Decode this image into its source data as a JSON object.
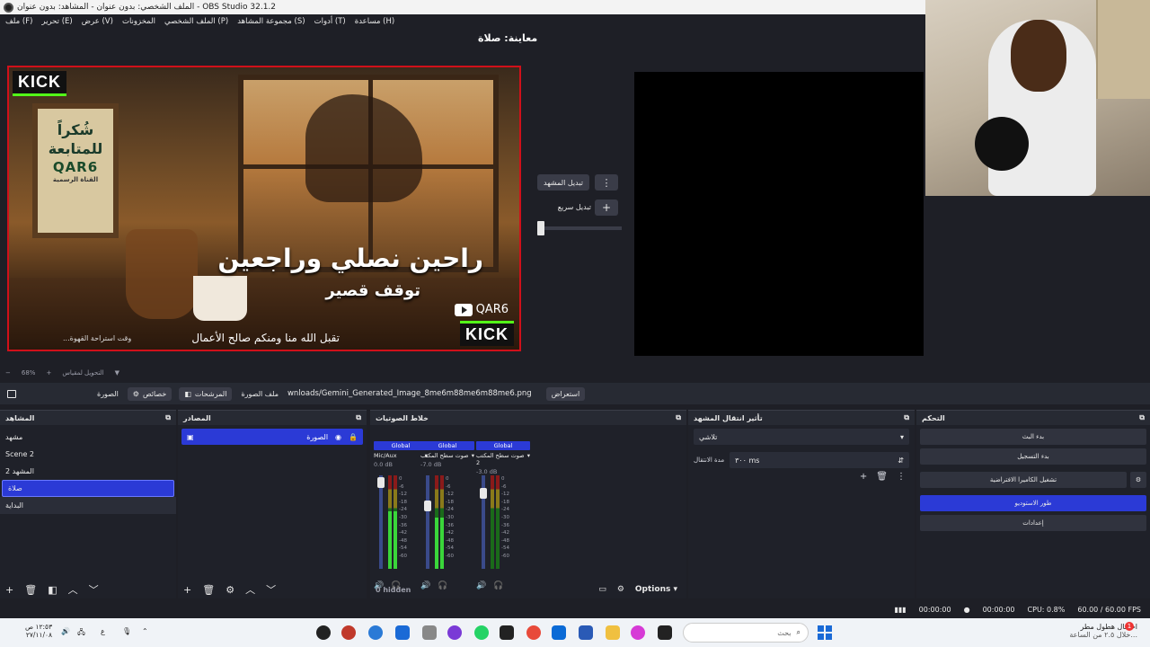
{
  "window": {
    "title": "الملف الشخصي: بدون عنوان - المشاهد: بدون عنوان - OBS Studio 32.1.2"
  },
  "menu": [
    "ملف (F)",
    "تحرير (E)",
    "عرض (V)",
    "المخزونات",
    "الملف الشخصي (P)",
    "مجموعة المشاهد (S)",
    "أدوات (T)",
    "مساعدة (H)"
  ],
  "preview": {
    "label": "معاينة: صلاة"
  },
  "canvas": {
    "kick": "KICK",
    "headline": "راحين نصلي وراجعين",
    "subheadline": "توقف قصير",
    "channel": "QAR6",
    "footer": "تقبل الله منا ومنكم صالح الأعمال",
    "footer_small": "وقت استراحة القهوة...",
    "frame_line1": "شُكراً",
    "frame_line2": "للمتابعة",
    "frame_brand": "QAR6",
    "frame_sub": "القناة الرسمية"
  },
  "transition_controls": {
    "scene_transition": "تبديل المشهد",
    "quick": "تبديل سريع"
  },
  "zoom": {
    "value": "68%",
    "hint": "التحويل لمقياس"
  },
  "context": {
    "source_name": "الصورة",
    "properties": "خصائص",
    "filters": "المرشحات",
    "image_file_label": "ملف الصورة",
    "image_file": "wnloads/Gemini_Generated_Image_8me6m88me6m88me6.png",
    "browse": "استعراض"
  },
  "scenes": {
    "title": "المشاهد",
    "items": [
      "مشهد",
      "Scene 2",
      "المشهد 2",
      "صلاة",
      "البداية"
    ],
    "selected": 3
  },
  "sources": {
    "title": "المصادر",
    "items": [
      {
        "name": "الصورة"
      }
    ]
  },
  "mixer": {
    "title": "خلاط الصوتيات",
    "channels": [
      {
        "global": "Global",
        "name": "Mic/Aux",
        "db": "0.0 dB",
        "level": 0.62
      },
      {
        "global": "Global",
        "name": "صوت سطح المكتب",
        "db": "-7.0 dB",
        "level": 0.55
      },
      {
        "global": "Global",
        "name": "صوت سطح المكتب 2",
        "db": "-3.0 dB",
        "level": 0.0
      }
    ],
    "scale": [
      "0",
      "-6",
      "-12",
      "-18",
      "-24",
      "-30",
      "-36",
      "-42",
      "-48",
      "-54",
      "-60"
    ],
    "hidden": "0 hidden",
    "options": "Options"
  },
  "transitions": {
    "title": "تأثير انتقال المشهد",
    "selected": "تلاشي",
    "duration_label": "مدة الانتقال",
    "duration_value": "٣٠٠ ms"
  },
  "controls": {
    "title": "التحكم",
    "buttons": [
      {
        "label": "بدء البث",
        "active": false
      },
      {
        "label": "بدء التسجيل",
        "active": false
      },
      {
        "label": "تشغيل الكاميرا الافتراضية",
        "active": false
      },
      {
        "label": "طور الاستوديو",
        "active": true
      },
      {
        "label": "إعدادات",
        "active": false
      }
    ]
  },
  "status": {
    "rec_time": "00:00:00",
    "stream_time": "00:00:00",
    "cpu": "CPU: 0.8%",
    "fps": "60.00 / 60.00 FPS"
  },
  "taskbar": {
    "time": "١٢:٥٣ ص",
    "date": "٢٧/١١/٠٨",
    "lang": "ع",
    "search": "بحث",
    "notif_title": "احتمال هطول مطر",
    "notif_sub": "خلال ٢.٥ من الساعة..."
  },
  "colors": {
    "accent": "#2b3ad6",
    "selection_border": "#d0101a",
    "kick_green": "#53fc18"
  }
}
